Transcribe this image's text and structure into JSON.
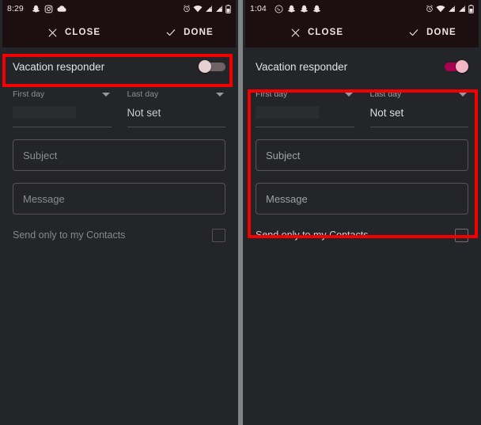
{
  "panels": [
    {
      "id": "left",
      "status": {
        "time": "8:29",
        "left_icons": [
          "snapchat-icon",
          "instagram-icon",
          "cloud-icon"
        ],
        "right_icons": [
          "alarm-icon",
          "wifi-icon",
          "signal-icon",
          "signal-icon-2",
          "battery-icon"
        ]
      },
      "appbar": {
        "close_label": "CLOSE",
        "done_label": "DONE"
      },
      "form": {
        "vacation_label": "Vacation responder",
        "toggle_state": "off",
        "first_day_label": "First day",
        "first_day_value": "",
        "last_day_label": "Last day",
        "last_day_value": "Not set",
        "subject_placeholder": "Subject",
        "message_placeholder": "Message",
        "contacts_label": "Send only to my Contacts",
        "contacts_checked": false
      },
      "highlight": "vacation-responder-row"
    },
    {
      "id": "right",
      "status": {
        "time": "1:04",
        "left_icons": [
          "whatsapp-icon",
          "snapchat-icon",
          "snapchat-icon-2",
          "snapchat-icon-3"
        ],
        "right_icons": [
          "alarm-icon",
          "wifi-icon",
          "signal-icon",
          "signal-icon-2",
          "battery-icon"
        ]
      },
      "appbar": {
        "close_label": "CLOSE",
        "done_label": "DONE"
      },
      "form": {
        "vacation_label": "Vacation responder",
        "toggle_state": "on",
        "first_day_label": "First day",
        "first_day_value": "",
        "last_day_label": "Last day",
        "last_day_value": "Not set",
        "subject_placeholder": "Subject",
        "message_placeholder": "Message",
        "contacts_label": "Send only to my Contacts",
        "contacts_checked": false
      },
      "highlight": "vacation-settings-fields"
    }
  ],
  "colors": {
    "accent_on": "#a8004f",
    "knob_on": "#f2b7c7",
    "knob_off": "#e7d0d2",
    "highlight": "#f50000",
    "statusbar_bg": "#1b0f11",
    "panel_bg": "#232528"
  }
}
